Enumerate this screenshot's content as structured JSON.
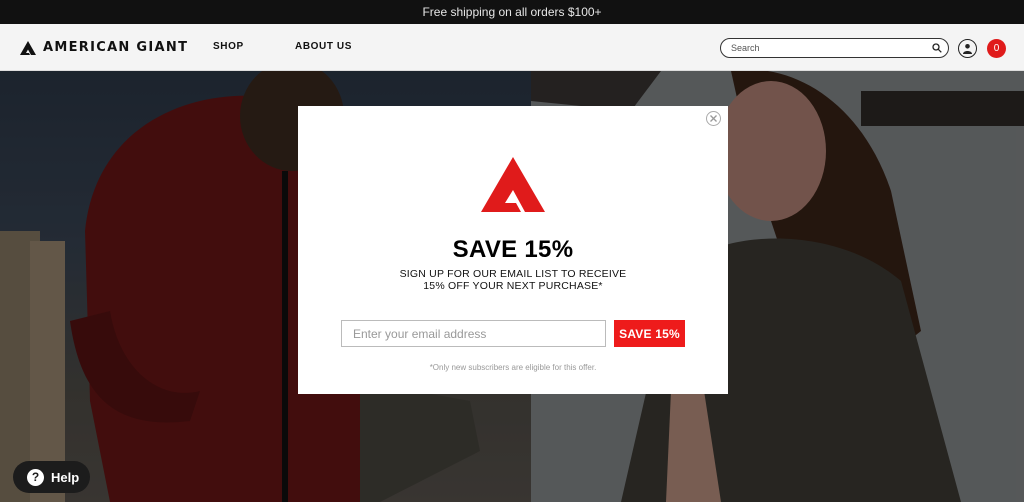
{
  "announcement": {
    "text": "Free shipping on all orders $100+"
  },
  "header": {
    "brand": "AMERICAN GIANT",
    "nav": [
      {
        "label": "SHOP"
      },
      {
        "label": "ABOUT US"
      }
    ],
    "search": {
      "placeholder": "Search",
      "value": ""
    },
    "cart_count": "0"
  },
  "modal": {
    "title": "SAVE 15%",
    "subtitle_line1": "SIGN UP FOR OUR EMAIL LIST TO RECEIVE",
    "subtitle_line2": "15% OFF YOUR NEXT PURCHASE*",
    "email_placeholder": "Enter your email address",
    "email_value": "",
    "submit_label": "SAVE 15%",
    "disclaimer": "*Only new subscribers are eligible for this offer."
  },
  "help": {
    "label": "Help"
  },
  "colors": {
    "accent": "#ee1b1b",
    "announcement_bg": "#111111",
    "help_bg": "#1c1c1c"
  },
  "icons": [
    "brand-logo-icon",
    "search-icon",
    "user-icon",
    "cart-icon",
    "close-icon",
    "help-icon"
  ]
}
